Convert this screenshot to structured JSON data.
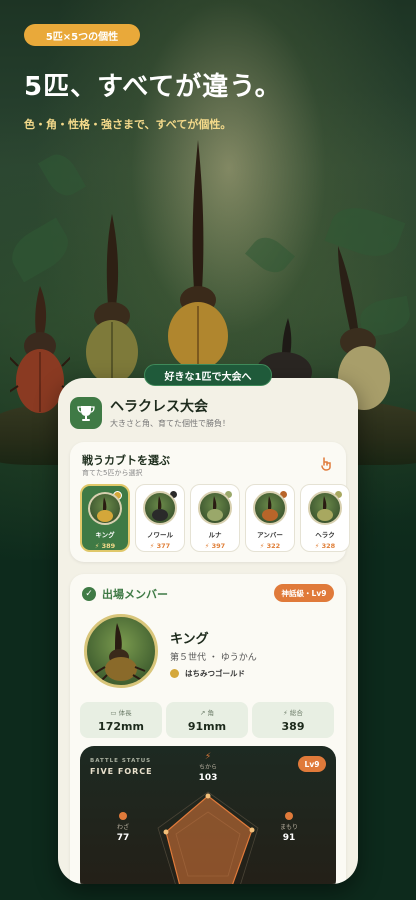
{
  "hero": {
    "tag": "5匹×5つの個性",
    "headline": "5匹、すべてが違う。",
    "subline": "色・角・性格・強さまで、すべてが個性。",
    "float_pill": "好きな1匹で大会へ"
  },
  "app": {
    "title": "ヘラクレス大会",
    "subtitle": "大きさと角、育てた個性で勝負！",
    "select": {
      "title": "戦うカブトを選ぶ",
      "subtitle": "育てた5匹から選択",
      "beetles": [
        {
          "name": "キング",
          "power": "389",
          "dot": "#d4a73a",
          "selected": true
        },
        {
          "name": "ノワール",
          "power": "377",
          "dot": "#2a2a2a",
          "selected": false
        },
        {
          "name": "ルナ",
          "power": "397",
          "dot": "#9aa86a",
          "selected": false
        },
        {
          "name": "アンバー",
          "power": "322",
          "dot": "#b8652a",
          "selected": false
        },
        {
          "name": "ヘラク",
          "power": "328",
          "dot": "#a8a860",
          "selected": false
        }
      ]
    },
    "member": {
      "title": "出場メンバー",
      "rank": "神話級・Lv9",
      "name": "キング",
      "generation": "第５世代 ・ ゆうかん",
      "color_name": "はちみつゴールド",
      "stats": [
        {
          "label": "体長",
          "value": "172mm"
        },
        {
          "label": "角",
          "value": "91mm"
        },
        {
          "label": "総合",
          "value": "389"
        }
      ]
    },
    "battle": {
      "small_label": "BATTLE STATUS",
      "big_label": "FIVE FORCE",
      "level": "Lv9",
      "axes": [
        {
          "label": "ちから",
          "value": "103"
        },
        {
          "label": "わざ",
          "value": "77"
        },
        {
          "label": "まもり",
          "value": "91"
        }
      ]
    }
  },
  "colors": {
    "accent_orange": "#e07a3a",
    "accent_green": "#3f7a45",
    "gold": "#e9a93a"
  }
}
